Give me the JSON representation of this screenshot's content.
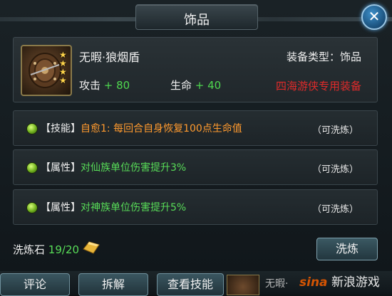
{
  "window": {
    "title": "饰品",
    "close_icon": "close-icon"
  },
  "item": {
    "name": "无暇·狼烟盾",
    "stars": 4,
    "equip_type": "装备类型：饰品",
    "stats": [
      {
        "label": "攻击",
        "value": "+ 80"
      },
      {
        "label": "生命",
        "value": "+ 40"
      }
    ],
    "exclusive": "四海游侠专用装备"
  },
  "attributes": [
    {
      "tag": "【技能】",
      "desc": "自愈1: 每回合自身恢复100点生命值",
      "wash": "（可洗炼）",
      "color": "#ff9a2e"
    },
    {
      "tag": "【属性】",
      "desc": "对仙族单位伤害提升3%",
      "wash": "（可洗炼）",
      "color": "#58dd58"
    },
    {
      "tag": "【属性】",
      "desc": "对神族单位伤害提升5%",
      "wash": "（可洗炼）",
      "color": "#58dd58"
    }
  ],
  "refine": {
    "stone_label": "洗炼石",
    "stone_count": "19/20",
    "button": "洗炼"
  },
  "bottom": {
    "buttons": [
      "评论",
      "拆解",
      "查看技能"
    ],
    "next_item_name": "无暇·",
    "watermark_brand": "sina",
    "watermark_text": "新浪游戏"
  }
}
